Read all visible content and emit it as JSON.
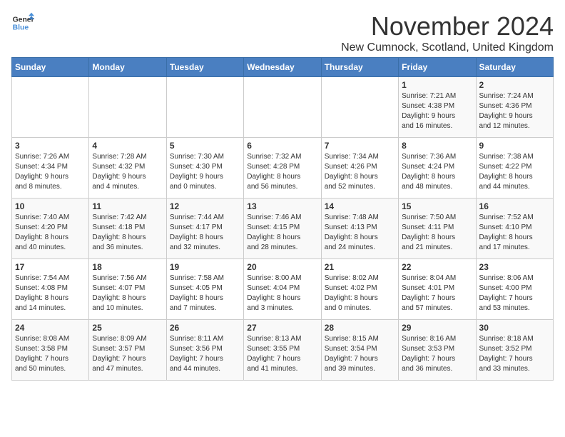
{
  "logo": {
    "line1": "General",
    "line2": "Blue"
  },
  "title": "November 2024",
  "subtitle": "New Cumnock, Scotland, United Kingdom",
  "days_of_week": [
    "Sunday",
    "Monday",
    "Tuesday",
    "Wednesday",
    "Thursday",
    "Friday",
    "Saturday"
  ],
  "weeks": [
    [
      {
        "day": "",
        "info": ""
      },
      {
        "day": "",
        "info": ""
      },
      {
        "day": "",
        "info": ""
      },
      {
        "day": "",
        "info": ""
      },
      {
        "day": "",
        "info": ""
      },
      {
        "day": "1",
        "info": "Sunrise: 7:21 AM\nSunset: 4:38 PM\nDaylight: 9 hours\nand 16 minutes."
      },
      {
        "day": "2",
        "info": "Sunrise: 7:24 AM\nSunset: 4:36 PM\nDaylight: 9 hours\nand 12 minutes."
      }
    ],
    [
      {
        "day": "3",
        "info": "Sunrise: 7:26 AM\nSunset: 4:34 PM\nDaylight: 9 hours\nand 8 minutes."
      },
      {
        "day": "4",
        "info": "Sunrise: 7:28 AM\nSunset: 4:32 PM\nDaylight: 9 hours\nand 4 minutes."
      },
      {
        "day": "5",
        "info": "Sunrise: 7:30 AM\nSunset: 4:30 PM\nDaylight: 9 hours\nand 0 minutes."
      },
      {
        "day": "6",
        "info": "Sunrise: 7:32 AM\nSunset: 4:28 PM\nDaylight: 8 hours\nand 56 minutes."
      },
      {
        "day": "7",
        "info": "Sunrise: 7:34 AM\nSunset: 4:26 PM\nDaylight: 8 hours\nand 52 minutes."
      },
      {
        "day": "8",
        "info": "Sunrise: 7:36 AM\nSunset: 4:24 PM\nDaylight: 8 hours\nand 48 minutes."
      },
      {
        "day": "9",
        "info": "Sunrise: 7:38 AM\nSunset: 4:22 PM\nDaylight: 8 hours\nand 44 minutes."
      }
    ],
    [
      {
        "day": "10",
        "info": "Sunrise: 7:40 AM\nSunset: 4:20 PM\nDaylight: 8 hours\nand 40 minutes."
      },
      {
        "day": "11",
        "info": "Sunrise: 7:42 AM\nSunset: 4:18 PM\nDaylight: 8 hours\nand 36 minutes."
      },
      {
        "day": "12",
        "info": "Sunrise: 7:44 AM\nSunset: 4:17 PM\nDaylight: 8 hours\nand 32 minutes."
      },
      {
        "day": "13",
        "info": "Sunrise: 7:46 AM\nSunset: 4:15 PM\nDaylight: 8 hours\nand 28 minutes."
      },
      {
        "day": "14",
        "info": "Sunrise: 7:48 AM\nSunset: 4:13 PM\nDaylight: 8 hours\nand 24 minutes."
      },
      {
        "day": "15",
        "info": "Sunrise: 7:50 AM\nSunset: 4:11 PM\nDaylight: 8 hours\nand 21 minutes."
      },
      {
        "day": "16",
        "info": "Sunrise: 7:52 AM\nSunset: 4:10 PM\nDaylight: 8 hours\nand 17 minutes."
      }
    ],
    [
      {
        "day": "17",
        "info": "Sunrise: 7:54 AM\nSunset: 4:08 PM\nDaylight: 8 hours\nand 14 minutes."
      },
      {
        "day": "18",
        "info": "Sunrise: 7:56 AM\nSunset: 4:07 PM\nDaylight: 8 hours\nand 10 minutes."
      },
      {
        "day": "19",
        "info": "Sunrise: 7:58 AM\nSunset: 4:05 PM\nDaylight: 8 hours\nand 7 minutes."
      },
      {
        "day": "20",
        "info": "Sunrise: 8:00 AM\nSunset: 4:04 PM\nDaylight: 8 hours\nand 3 minutes."
      },
      {
        "day": "21",
        "info": "Sunrise: 8:02 AM\nSunset: 4:02 PM\nDaylight: 8 hours\nand 0 minutes."
      },
      {
        "day": "22",
        "info": "Sunrise: 8:04 AM\nSunset: 4:01 PM\nDaylight: 7 hours\nand 57 minutes."
      },
      {
        "day": "23",
        "info": "Sunrise: 8:06 AM\nSunset: 4:00 PM\nDaylight: 7 hours\nand 53 minutes."
      }
    ],
    [
      {
        "day": "24",
        "info": "Sunrise: 8:08 AM\nSunset: 3:58 PM\nDaylight: 7 hours\nand 50 minutes."
      },
      {
        "day": "25",
        "info": "Sunrise: 8:09 AM\nSunset: 3:57 PM\nDaylight: 7 hours\nand 47 minutes."
      },
      {
        "day": "26",
        "info": "Sunrise: 8:11 AM\nSunset: 3:56 PM\nDaylight: 7 hours\nand 44 minutes."
      },
      {
        "day": "27",
        "info": "Sunrise: 8:13 AM\nSunset: 3:55 PM\nDaylight: 7 hours\nand 41 minutes."
      },
      {
        "day": "28",
        "info": "Sunrise: 8:15 AM\nSunset: 3:54 PM\nDaylight: 7 hours\nand 39 minutes."
      },
      {
        "day": "29",
        "info": "Sunrise: 8:16 AM\nSunset: 3:53 PM\nDaylight: 7 hours\nand 36 minutes."
      },
      {
        "day": "30",
        "info": "Sunrise: 8:18 AM\nSunset: 3:52 PM\nDaylight: 7 hours\nand 33 minutes."
      }
    ]
  ]
}
